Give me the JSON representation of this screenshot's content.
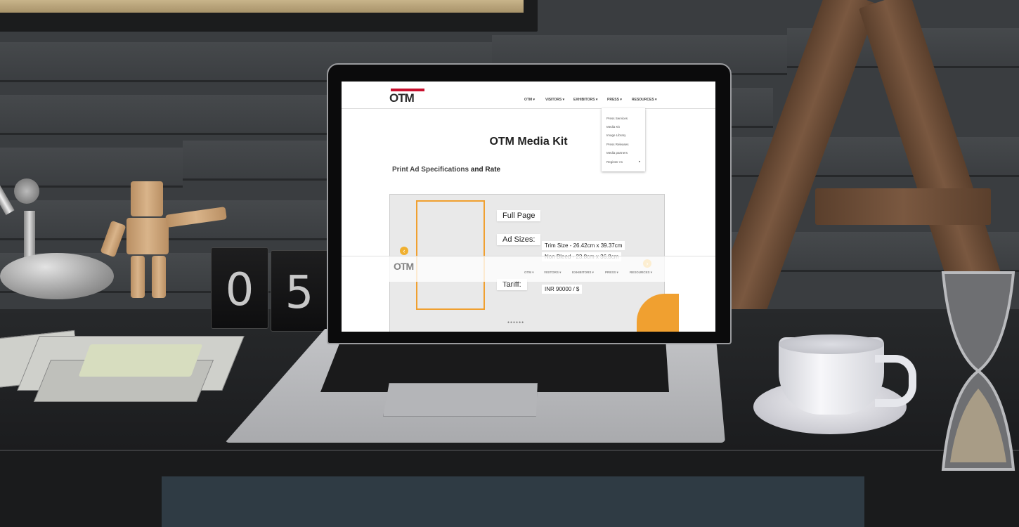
{
  "site": {
    "logo_text": "OTM",
    "nav": [
      "OTM ▾",
      "VISITORS ▾",
      "EXHIBITORS ▾",
      "PRESS ▾",
      "RESOURCES ▾"
    ],
    "press_dropdown": [
      "Press Services",
      "Media Kit",
      "Image Library",
      "Press Releases",
      "Media partners",
      "Register As"
    ],
    "dropdown_arrow": "▸"
  },
  "page": {
    "title": "OTM Media Kit",
    "subtitle_light": "Print Ad Specifications",
    "subtitle_dark": "and Rate"
  },
  "slide": {
    "format_label": "Full Page",
    "sizes_label": "Ad Sizes:",
    "trim_size": "Trim Size - 26.42cm x 39.37cm",
    "non_bleed": "Non Bleed - 23.8cm x 36.8cm",
    "tariff_label": "Tariff:",
    "tariff_value": "INR 90000 / $",
    "prev_arrow": "‹",
    "next_arrow": "›",
    "pager_dots": "●●●●●●"
  },
  "scene": {
    "clock_digits": [
      "0",
      "5"
    ],
    "colors": {
      "accent_orange": "#f0a030",
      "logo_red": "#c8102e"
    }
  }
}
